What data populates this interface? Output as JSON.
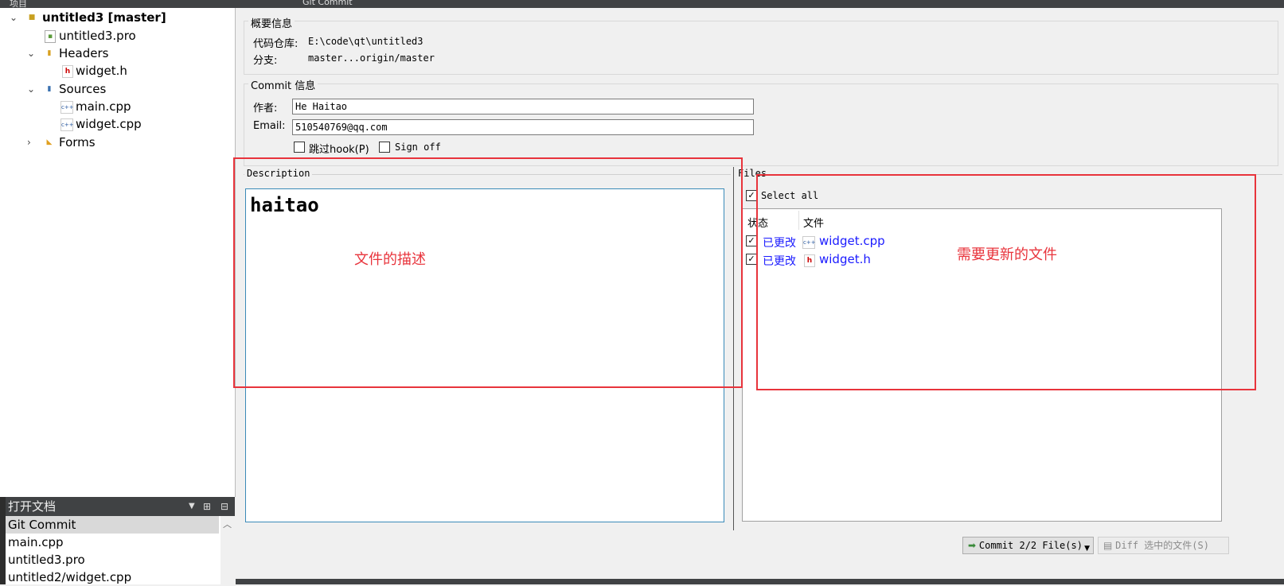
{
  "topbar": {
    "project_label": "项目",
    "tab_title": "Git Commit"
  },
  "project_tree": [
    {
      "label": "untitled3 [master]",
      "bold": true,
      "level": 0,
      "expanded": true,
      "icon": "project-icon"
    },
    {
      "label": "untitled3.pro",
      "level": 1,
      "icon": "pro-file-icon"
    },
    {
      "label": "Headers",
      "level": 1,
      "expanded": true,
      "icon": "headers-folder-icon"
    },
    {
      "label": "widget.h",
      "level": 2,
      "icon": "header-file-icon"
    },
    {
      "label": "Sources",
      "level": 1,
      "expanded": true,
      "icon": "sources-folder-icon"
    },
    {
      "label": "main.cpp",
      "level": 2,
      "icon": "cpp-file-icon"
    },
    {
      "label": "widget.cpp",
      "level": 2,
      "icon": "cpp-file-icon"
    },
    {
      "label": "Forms",
      "level": 1,
      "expanded": false,
      "icon": "forms-folder-icon"
    }
  ],
  "open_documents": {
    "header": "打开文档",
    "items": [
      "Git Commit",
      "main.cpp",
      "untitled3.pro",
      "untitled2/widget.cpp"
    ],
    "selected": 0
  },
  "summary": {
    "title": "概要信息",
    "repo_label": "代码仓库:",
    "repo_value": "E:\\code\\qt\\untitled3",
    "branch_label": "分支:",
    "branch_value": "master...origin/master"
  },
  "commit_info": {
    "title": "Commit 信息",
    "author_label": "作者:",
    "author_value": "He Haitao",
    "email_label": "Email:",
    "email_value": "510540769@qq.com",
    "skip_hook_label": "跳过hook(P)",
    "sign_off_label": "Sign off"
  },
  "description": {
    "title": "Description",
    "text": "haitao"
  },
  "files": {
    "title": "Files",
    "select_all_label": "Select all",
    "columns": [
      "状态",
      "文件"
    ],
    "rows": [
      {
        "status": "已更改",
        "name": "widget.cpp",
        "icon": "cpp-file-icon"
      },
      {
        "status": "已更改",
        "name": "widget.h",
        "icon": "header-file-icon"
      }
    ]
  },
  "annotations": {
    "description_note": "文件的描述",
    "files_note": "需要更新的文件"
  },
  "buttons": {
    "commit": "Commit 2/2 File(s)",
    "diff": "Diff 选中的文件(S)"
  },
  "colors": {
    "annotation": "#e8343c",
    "link": "#1a1aff",
    "panel_dark": "#404244"
  }
}
